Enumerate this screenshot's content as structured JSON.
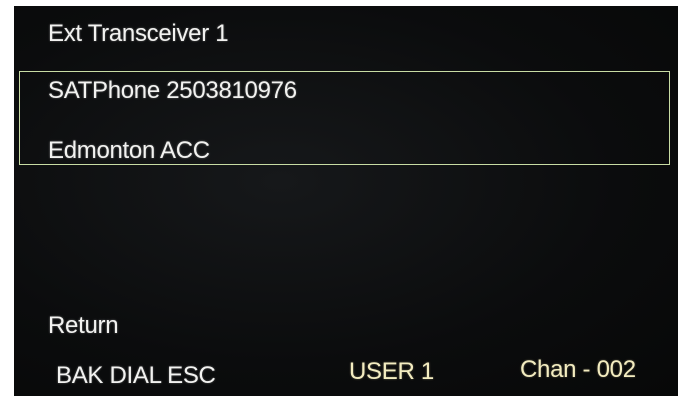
{
  "header": {
    "title": "Ext Transceiver 1"
  },
  "contact": {
    "number": "SATPhone 2503810976",
    "name": "Edmonton ACC"
  },
  "menu": {
    "return_label": "Return"
  },
  "status_bar": {
    "softkeys": "BAK DIAL ESC",
    "user": "USER 1",
    "channel": "Chan -  002"
  },
  "colors": {
    "background": "#0a0b0c",
    "text": "#f2f2f0",
    "highlight_border": "#c8dca4"
  }
}
